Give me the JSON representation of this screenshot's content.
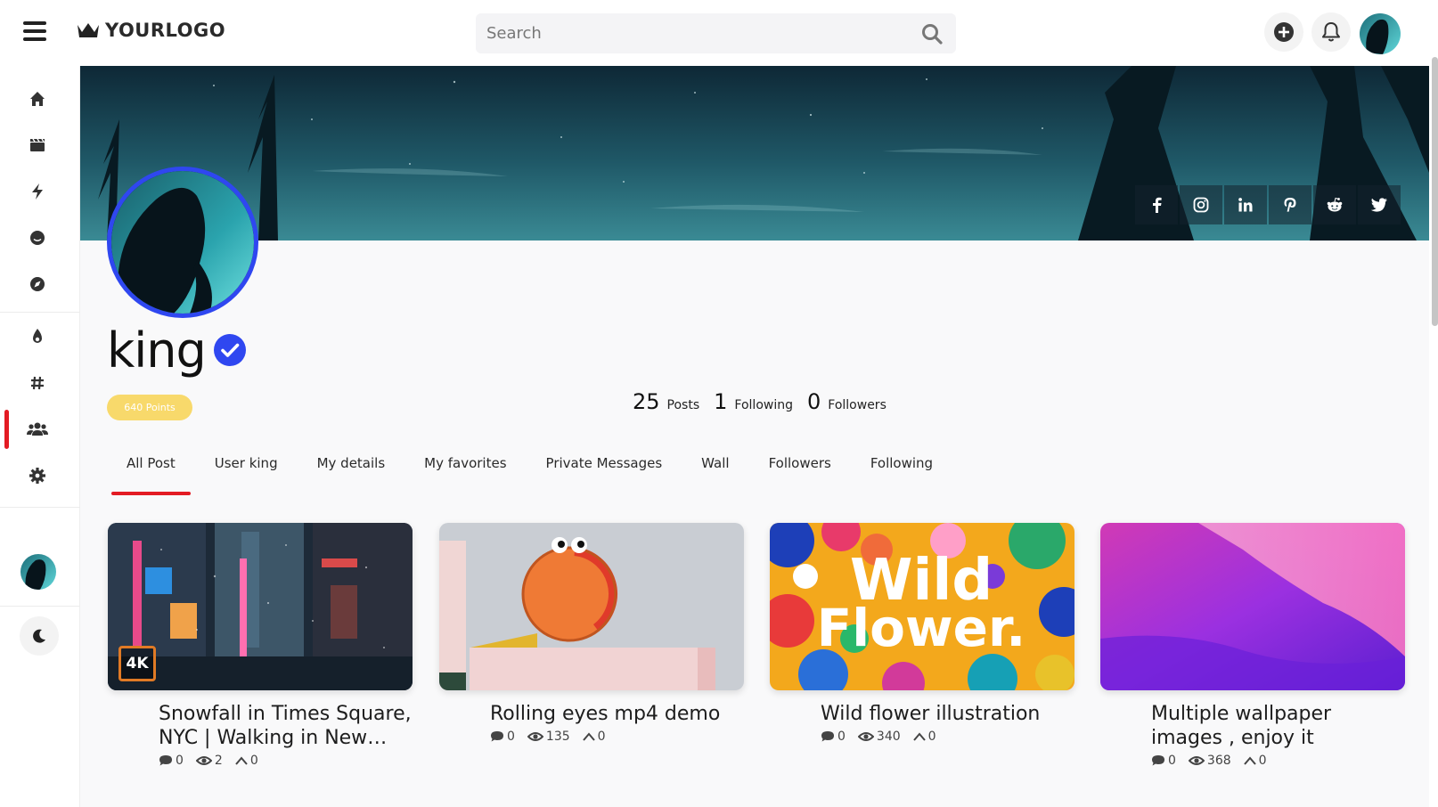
{
  "header": {
    "logo_text": "YOURLOGO",
    "search_placeholder": "Search"
  },
  "profile": {
    "username": "king",
    "points": "640 Points",
    "stats": [
      {
        "value": "25",
        "label": "Posts"
      },
      {
        "value": "1",
        "label": "Following"
      },
      {
        "value": "0",
        "label": "Followers"
      }
    ]
  },
  "tabs": [
    "All Post",
    "User king",
    "My details",
    "My favorites",
    "Private Messages",
    "Wall",
    "Followers",
    "Following"
  ],
  "posts": [
    {
      "title": "Snowfall in Times Square, NYC | Walking in New York City",
      "comments": "0",
      "views": "2",
      "votes": "0",
      "badge": "4K"
    },
    {
      "title": "Rolling eyes mp4 demo",
      "comments": "0",
      "views": "135",
      "votes": "0"
    },
    {
      "title": "Wild flower illustration",
      "comments": "0",
      "views": "340",
      "votes": "0",
      "thumb_text_1": "Wild",
      "thumb_text_2": "Flower."
    },
    {
      "title": "Multiple wallpaper images , enjoy it",
      "comments": "0",
      "views": "368",
      "votes": "0"
    }
  ],
  "colors": {
    "accent": "#e31b23",
    "verified": "#2f47f0",
    "points_badge": "#f8d96b"
  },
  "icons": {
    "sidebar": [
      "home-icon",
      "clapperboard-icon",
      "bolt-icon",
      "smiley-icon",
      "compass-icon",
      "fire-icon",
      "hashtag-icon",
      "users-icon",
      "gear-icon"
    ],
    "social": [
      "facebook-icon",
      "instagram-icon",
      "linkedin-icon",
      "pinterest-icon",
      "reddit-icon",
      "twitter-icon"
    ]
  }
}
